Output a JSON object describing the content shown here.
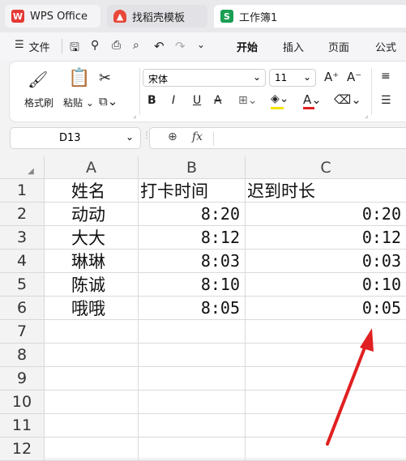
{
  "tabs": [
    {
      "label": "WPS Office",
      "icon": "wps-logo-icon"
    },
    {
      "label": "找稻壳模板",
      "icon": "docer-icon"
    },
    {
      "label": "工作簿1",
      "icon": "spreadsheet-icon",
      "icon_glyph": "S"
    }
  ],
  "menu": {
    "file_label": "文件",
    "tabs": [
      "开始",
      "插入",
      "页面",
      "公式"
    ],
    "active_tab": "开始"
  },
  "ribbon": {
    "format_painter": "格式刷",
    "paste": "粘贴",
    "font_name": "宋体",
    "font_size": "11"
  },
  "formula_bar": {
    "name_box": "D13",
    "fx_label": "fx",
    "content": ""
  },
  "grid": {
    "columns": [
      "A",
      "B",
      "C"
    ],
    "rows": [
      {
        "n": "1",
        "cells": [
          "姓名",
          "打卡时间",
          "迟到时长"
        ]
      },
      {
        "n": "2",
        "cells": [
          "动动",
          "8:20",
          "0:20"
        ]
      },
      {
        "n": "3",
        "cells": [
          "大大",
          "8:12",
          "0:12"
        ]
      },
      {
        "n": "4",
        "cells": [
          "琳琳",
          "8:03",
          "0:03"
        ]
      },
      {
        "n": "5",
        "cells": [
          "陈诚",
          "8:10",
          "0:10"
        ]
      },
      {
        "n": "6",
        "cells": [
          "哦哦",
          "8:05",
          "0:05"
        ]
      },
      {
        "n": "7",
        "cells": [
          "",
          "",
          ""
        ]
      },
      {
        "n": "8",
        "cells": [
          "",
          "",
          ""
        ]
      },
      {
        "n": "9",
        "cells": [
          "",
          "",
          ""
        ]
      },
      {
        "n": "10",
        "cells": [
          "",
          "",
          ""
        ]
      },
      {
        "n": "11",
        "cells": [
          "",
          "",
          ""
        ]
      },
      {
        "n": "12",
        "cells": [
          "",
          "",
          ""
        ]
      }
    ]
  },
  "annotation": {
    "arrow_color": "#e02020"
  },
  "colors": {
    "accent_green": "#1a9e53",
    "wps_red": "#e53935",
    "active_tab_underline": "#1a9e53"
  }
}
